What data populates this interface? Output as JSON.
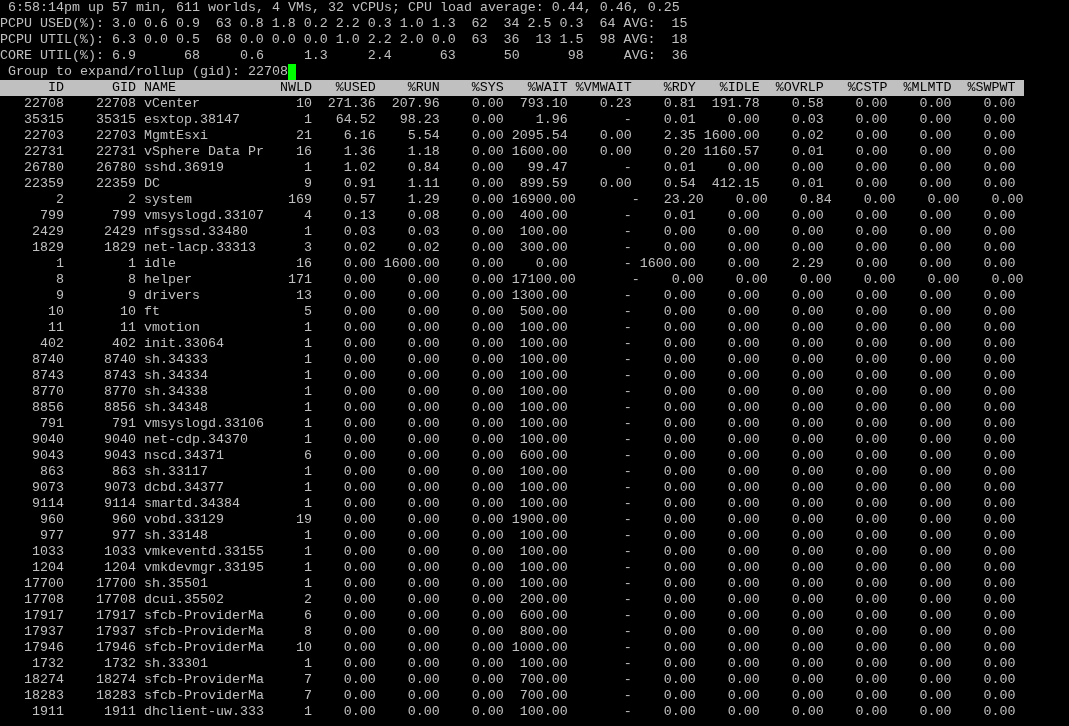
{
  "summary": "6:58:14pm up 57 min, 611 worlds, 4 VMs, 32 vCPUs; CPU load average: 0.44, 0.46, 0.25",
  "stats": [
    {
      "kind": "per_cpu",
      "label": "PCPU USED(%):",
      "values": [
        "3.0",
        "0.6",
        "0.9",
        "63",
        "0.8",
        "1.8",
        "0.2",
        "2.2",
        "0.3",
        "1.0",
        "1.3",
        "62",
        "34",
        "2.5",
        "0.3",
        "64"
      ],
      "avg_label": "AVG:",
      "avg": "15"
    },
    {
      "kind": "per_cpu",
      "label": "PCPU UTIL(%):",
      "values": [
        "6.3",
        "0.0",
        "0.5",
        "68",
        "0.0",
        "0.0",
        "0.0",
        "1.0",
        "2.2",
        "2.0",
        "0.0",
        "63",
        "36",
        "13",
        "1.5",
        "98"
      ],
      "avg_label": "AVG:",
      "avg": "18"
    },
    {
      "kind": "per_core",
      "label": "CORE UTIL(%):",
      "values": [
        "6.9",
        "68",
        "0.6",
        "1.3",
        "2.4",
        "63",
        "50",
        "98"
      ],
      "avg_label": "AVG:",
      "avg": "36"
    }
  ],
  "prompt": {
    "label": "Group to expand/rollup (gid):",
    "value": "22708"
  },
  "table": {
    "columns": [
      "ID",
      "GID",
      "NAME",
      "NWLD",
      "%USED",
      "%RUN",
      "%SYS",
      "%WAIT",
      "%VMWAIT",
      "%RDY",
      "%IDLE",
      "%OVRLP",
      "%CSTP",
      "%MLMTD",
      "%SWPWT"
    ],
    "rows": [
      [
        "22708",
        "22708",
        "vCenter",
        "10",
        "271.36",
        "207.96",
        "0.00",
        "793.10",
        "0.23",
        "0.81",
        "191.78",
        "0.58",
        "0.00",
        "0.00",
        "0.00"
      ],
      [
        "35315",
        "35315",
        "esxtop.38147",
        "1",
        "64.52",
        "98.23",
        "0.00",
        "1.96",
        "-",
        "0.01",
        "0.00",
        "0.03",
        "0.00",
        "0.00",
        "0.00"
      ],
      [
        "22703",
        "22703",
        "MgmtEsxi",
        "21",
        "6.16",
        "5.54",
        "0.00",
        "2095.54",
        "0.00",
        "2.35",
        "1600.00",
        "0.02",
        "0.00",
        "0.00",
        "0.00"
      ],
      [
        "22731",
        "22731",
        "vSphere Data Pr",
        "16",
        "1.36",
        "1.18",
        "0.00",
        "1600.00",
        "0.00",
        "0.20",
        "1160.57",
        "0.01",
        "0.00",
        "0.00",
        "0.00"
      ],
      [
        "26780",
        "26780",
        "sshd.36919",
        "1",
        "1.02",
        "0.84",
        "0.00",
        "99.47",
        "-",
        "0.01",
        "0.00",
        "0.00",
        "0.00",
        "0.00",
        "0.00"
      ],
      [
        "22359",
        "22359",
        "DC",
        "9",
        "0.91",
        "1.11",
        "0.00",
        "899.59",
        "0.00",
        "0.54",
        "412.15",
        "0.01",
        "0.00",
        "0.00",
        "0.00"
      ],
      [
        "2",
        "2",
        "system",
        "169",
        "0.57",
        "1.29",
        "0.00",
        "16900.00",
        "-",
        "23.20",
        "0.00",
        "0.84",
        "0.00",
        "0.00",
        "0.00"
      ],
      [
        "799",
        "799",
        "vmsyslogd.33107",
        "4",
        "0.13",
        "0.08",
        "0.00",
        "400.00",
        "-",
        "0.01",
        "0.00",
        "0.00",
        "0.00",
        "0.00",
        "0.00"
      ],
      [
        "2429",
        "2429",
        "nfsgssd.33480",
        "1",
        "0.03",
        "0.03",
        "0.00",
        "100.00",
        "-",
        "0.00",
        "0.00",
        "0.00",
        "0.00",
        "0.00",
        "0.00"
      ],
      [
        "1829",
        "1829",
        "net-lacp.33313",
        "3",
        "0.02",
        "0.02",
        "0.00",
        "300.00",
        "-",
        "0.00",
        "0.00",
        "0.00",
        "0.00",
        "0.00",
        "0.00"
      ],
      [
        "1",
        "1",
        "idle",
        "16",
        "0.00",
        "1600.00",
        "0.00",
        "0.00",
        "-",
        "1600.00",
        "0.00",
        "2.29",
        "0.00",
        "0.00",
        "0.00"
      ],
      [
        "8",
        "8",
        "helper",
        "171",
        "0.00",
        "0.00",
        "0.00",
        "17100.00",
        "-",
        "0.00",
        "0.00",
        "0.00",
        "0.00",
        "0.00",
        "0.00"
      ],
      [
        "9",
        "9",
        "drivers",
        "13",
        "0.00",
        "0.00",
        "0.00",
        "1300.00",
        "-",
        "0.00",
        "0.00",
        "0.00",
        "0.00",
        "0.00",
        "0.00"
      ],
      [
        "10",
        "10",
        "ft",
        "5",
        "0.00",
        "0.00",
        "0.00",
        "500.00",
        "-",
        "0.00",
        "0.00",
        "0.00",
        "0.00",
        "0.00",
        "0.00"
      ],
      [
        "11",
        "11",
        "vmotion",
        "1",
        "0.00",
        "0.00",
        "0.00",
        "100.00",
        "-",
        "0.00",
        "0.00",
        "0.00",
        "0.00",
        "0.00",
        "0.00"
      ],
      [
        "402",
        "402",
        "init.33064",
        "1",
        "0.00",
        "0.00",
        "0.00",
        "100.00",
        "-",
        "0.00",
        "0.00",
        "0.00",
        "0.00",
        "0.00",
        "0.00"
      ],
      [
        "8740",
        "8740",
        "sh.34333",
        "1",
        "0.00",
        "0.00",
        "0.00",
        "100.00",
        "-",
        "0.00",
        "0.00",
        "0.00",
        "0.00",
        "0.00",
        "0.00"
      ],
      [
        "8743",
        "8743",
        "sh.34334",
        "1",
        "0.00",
        "0.00",
        "0.00",
        "100.00",
        "-",
        "0.00",
        "0.00",
        "0.00",
        "0.00",
        "0.00",
        "0.00"
      ],
      [
        "8770",
        "8770",
        "sh.34338",
        "1",
        "0.00",
        "0.00",
        "0.00",
        "100.00",
        "-",
        "0.00",
        "0.00",
        "0.00",
        "0.00",
        "0.00",
        "0.00"
      ],
      [
        "8856",
        "8856",
        "sh.34348",
        "1",
        "0.00",
        "0.00",
        "0.00",
        "100.00",
        "-",
        "0.00",
        "0.00",
        "0.00",
        "0.00",
        "0.00",
        "0.00"
      ],
      [
        "791",
        "791",
        "vmsyslogd.33106",
        "1",
        "0.00",
        "0.00",
        "0.00",
        "100.00",
        "-",
        "0.00",
        "0.00",
        "0.00",
        "0.00",
        "0.00",
        "0.00"
      ],
      [
        "9040",
        "9040",
        "net-cdp.34370",
        "1",
        "0.00",
        "0.00",
        "0.00",
        "100.00",
        "-",
        "0.00",
        "0.00",
        "0.00",
        "0.00",
        "0.00",
        "0.00"
      ],
      [
        "9043",
        "9043",
        "nscd.34371",
        "6",
        "0.00",
        "0.00",
        "0.00",
        "600.00",
        "-",
        "0.00",
        "0.00",
        "0.00",
        "0.00",
        "0.00",
        "0.00"
      ],
      [
        "863",
        "863",
        "sh.33117",
        "1",
        "0.00",
        "0.00",
        "0.00",
        "100.00",
        "-",
        "0.00",
        "0.00",
        "0.00",
        "0.00",
        "0.00",
        "0.00"
      ],
      [
        "9073",
        "9073",
        "dcbd.34377",
        "1",
        "0.00",
        "0.00",
        "0.00",
        "100.00",
        "-",
        "0.00",
        "0.00",
        "0.00",
        "0.00",
        "0.00",
        "0.00"
      ],
      [
        "9114",
        "9114",
        "smartd.34384",
        "1",
        "0.00",
        "0.00",
        "0.00",
        "100.00",
        "-",
        "0.00",
        "0.00",
        "0.00",
        "0.00",
        "0.00",
        "0.00"
      ],
      [
        "960",
        "960",
        "vobd.33129",
        "19",
        "0.00",
        "0.00",
        "0.00",
        "1900.00",
        "-",
        "0.00",
        "0.00",
        "0.00",
        "0.00",
        "0.00",
        "0.00"
      ],
      [
        "977",
        "977",
        "sh.33148",
        "1",
        "0.00",
        "0.00",
        "0.00",
        "100.00",
        "-",
        "0.00",
        "0.00",
        "0.00",
        "0.00",
        "0.00",
        "0.00"
      ],
      [
        "1033",
        "1033",
        "vmkeventd.33155",
        "1",
        "0.00",
        "0.00",
        "0.00",
        "100.00",
        "-",
        "0.00",
        "0.00",
        "0.00",
        "0.00",
        "0.00",
        "0.00"
      ],
      [
        "1204",
        "1204",
        "vmkdevmgr.33195",
        "1",
        "0.00",
        "0.00",
        "0.00",
        "100.00",
        "-",
        "0.00",
        "0.00",
        "0.00",
        "0.00",
        "0.00",
        "0.00"
      ],
      [
        "17700",
        "17700",
        "sh.35501",
        "1",
        "0.00",
        "0.00",
        "0.00",
        "100.00",
        "-",
        "0.00",
        "0.00",
        "0.00",
        "0.00",
        "0.00",
        "0.00"
      ],
      [
        "17708",
        "17708",
        "dcui.35502",
        "2",
        "0.00",
        "0.00",
        "0.00",
        "200.00",
        "-",
        "0.00",
        "0.00",
        "0.00",
        "0.00",
        "0.00",
        "0.00"
      ],
      [
        "17917",
        "17917",
        "sfcb-ProviderMa",
        "6",
        "0.00",
        "0.00",
        "0.00",
        "600.00",
        "-",
        "0.00",
        "0.00",
        "0.00",
        "0.00",
        "0.00",
        "0.00"
      ],
      [
        "17937",
        "17937",
        "sfcb-ProviderMa",
        "8",
        "0.00",
        "0.00",
        "0.00",
        "800.00",
        "-",
        "0.00",
        "0.00",
        "0.00",
        "0.00",
        "0.00",
        "0.00"
      ],
      [
        "17946",
        "17946",
        "sfcb-ProviderMa",
        "10",
        "0.00",
        "0.00",
        "0.00",
        "1000.00",
        "-",
        "0.00",
        "0.00",
        "0.00",
        "0.00",
        "0.00",
        "0.00"
      ],
      [
        "1732",
        "1732",
        "sh.33301",
        "1",
        "0.00",
        "0.00",
        "0.00",
        "100.00",
        "-",
        "0.00",
        "0.00",
        "0.00",
        "0.00",
        "0.00",
        "0.00"
      ],
      [
        "18274",
        "18274",
        "sfcb-ProviderMa",
        "7",
        "0.00",
        "0.00",
        "0.00",
        "700.00",
        "-",
        "0.00",
        "0.00",
        "0.00",
        "0.00",
        "0.00",
        "0.00"
      ],
      [
        "18283",
        "18283",
        "sfcb-ProviderMa",
        "7",
        "0.00",
        "0.00",
        "0.00",
        "700.00",
        "-",
        "0.00",
        "0.00",
        "0.00",
        "0.00",
        "0.00",
        "0.00"
      ],
      [
        "1911",
        "1911",
        "dhclient-uw.333",
        "1",
        "0.00",
        "0.00",
        "0.00",
        "100.00",
        "-",
        "0.00",
        "0.00",
        "0.00",
        "0.00",
        "0.00",
        "0.00"
      ]
    ]
  }
}
